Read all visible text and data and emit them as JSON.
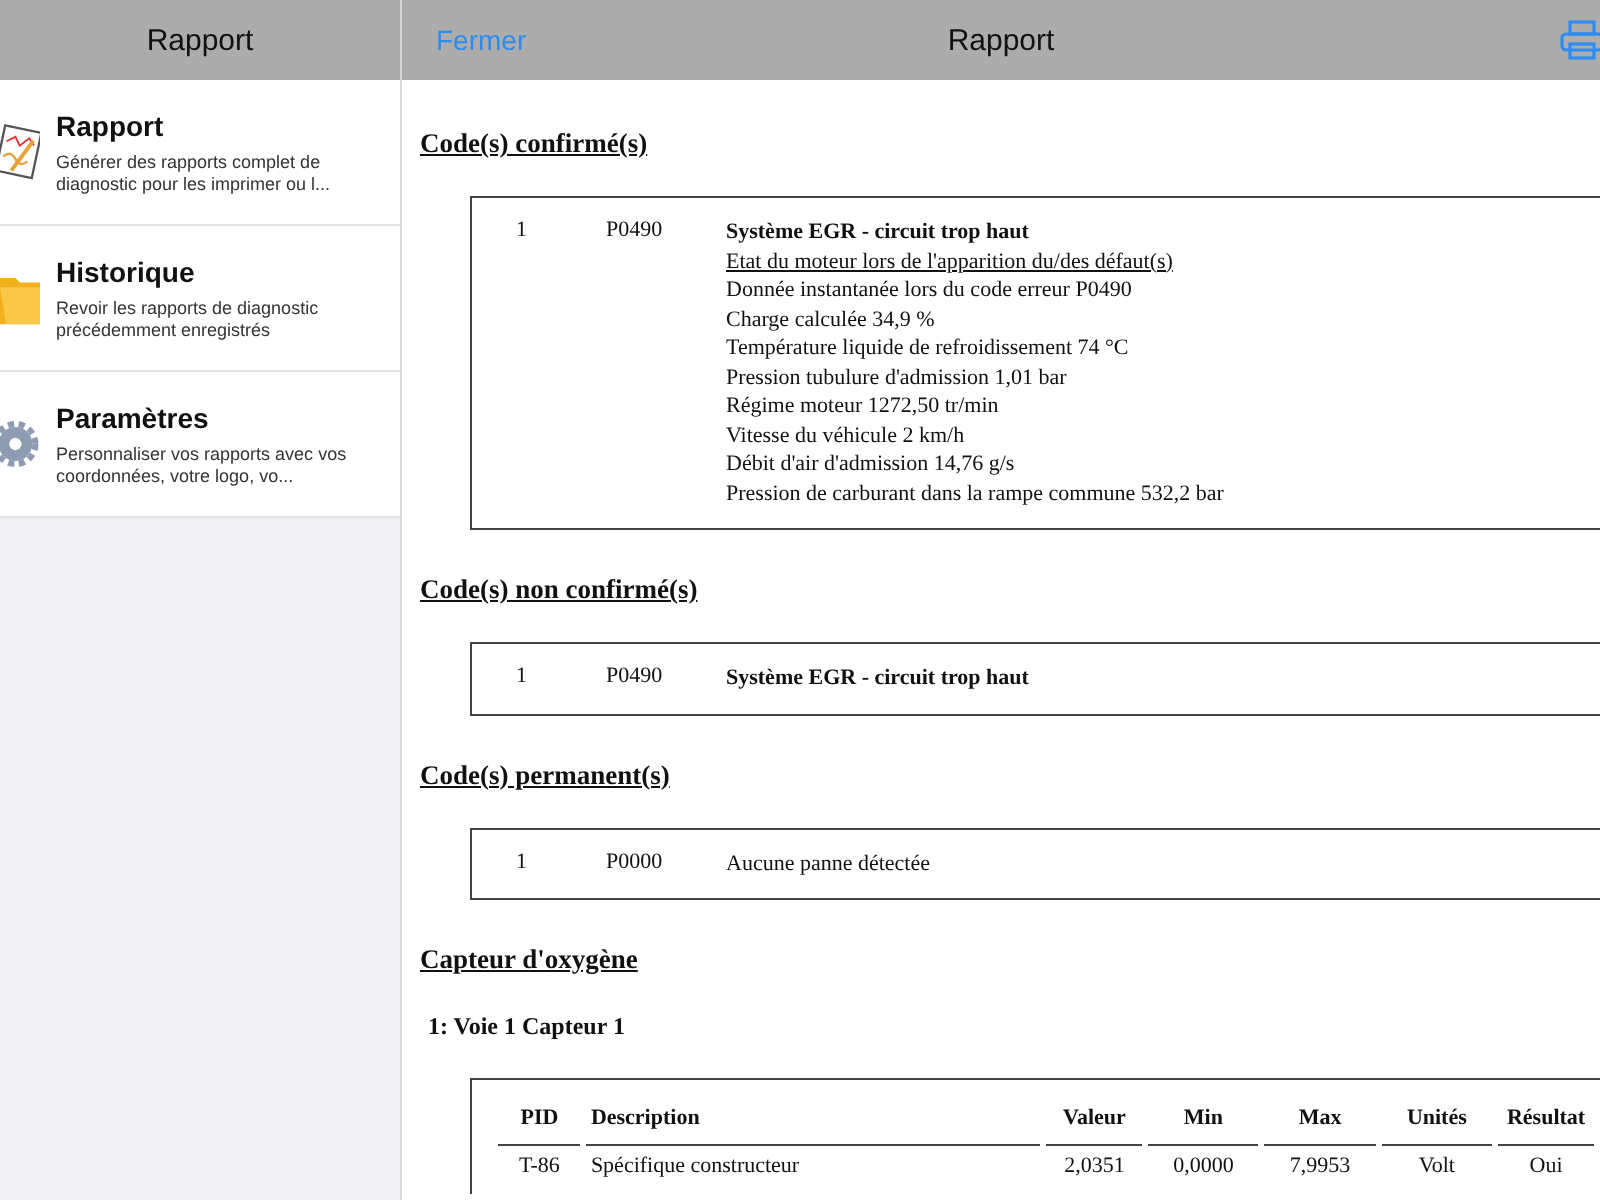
{
  "sidebar": {
    "title": "Rapport",
    "items": [
      {
        "kind": "report",
        "title": "Rapport",
        "subtitle": "Générer des rapports complet de diagnostic pour les imprimer ou l..."
      },
      {
        "kind": "history",
        "title": "Historique",
        "subtitle": "Revoir les rapports de diagnostic précédemment enregistrés"
      },
      {
        "kind": "settings",
        "title": "Paramètres",
        "subtitle": "Personnaliser vos rapports avec vos coordonnées, votre logo, vo..."
      }
    ]
  },
  "header": {
    "close": "Fermer",
    "title": "Rapport"
  },
  "sections": [
    {
      "title": "Code(s) confirmé(s)",
      "codes": [
        {
          "index": "1",
          "code": "P0490",
          "description": "Système EGR - circuit trop haut",
          "plain": false,
          "details_title": "Etat du moteur lors de l'apparition du/des défaut(s)",
          "details": [
            "Donnée instantanée lors du code erreur P0490",
            "Charge calculée 34,9 %",
            "Température liquide de refroidissement 74 °C",
            "Pression tubulure d'admission 1,01 bar",
            "Régime moteur 1272,50 tr/min",
            "Vitesse du véhicule 2 km/h",
            "Débit d'air d'admission 14,76 g/s",
            "Pression de carburant dans la rampe commune 532,2 bar"
          ]
        }
      ]
    },
    {
      "title": "Code(s) non confirmé(s)",
      "codes": [
        {
          "index": "1",
          "code": "P0490",
          "description": "Système EGR - circuit trop haut",
          "plain": false
        }
      ]
    },
    {
      "title": "Code(s) permanent(s)",
      "codes": [
        {
          "index": "1",
          "code": "P0000",
          "description": "Aucune panne détectée",
          "plain": true
        }
      ]
    }
  ],
  "oxygen": {
    "title": "Capteur d'oxygène",
    "subtitle": "1: Voie 1 Capteur 1",
    "columns": [
      "PID",
      "Description",
      "Valeur",
      "Min",
      "Max",
      "Unités",
      "Résultat"
    ],
    "rows": [
      [
        "T-86",
        "Spécifique constructeur",
        "2,0351",
        "0,0000",
        "7,9953",
        "Volt",
        "Oui"
      ]
    ]
  }
}
